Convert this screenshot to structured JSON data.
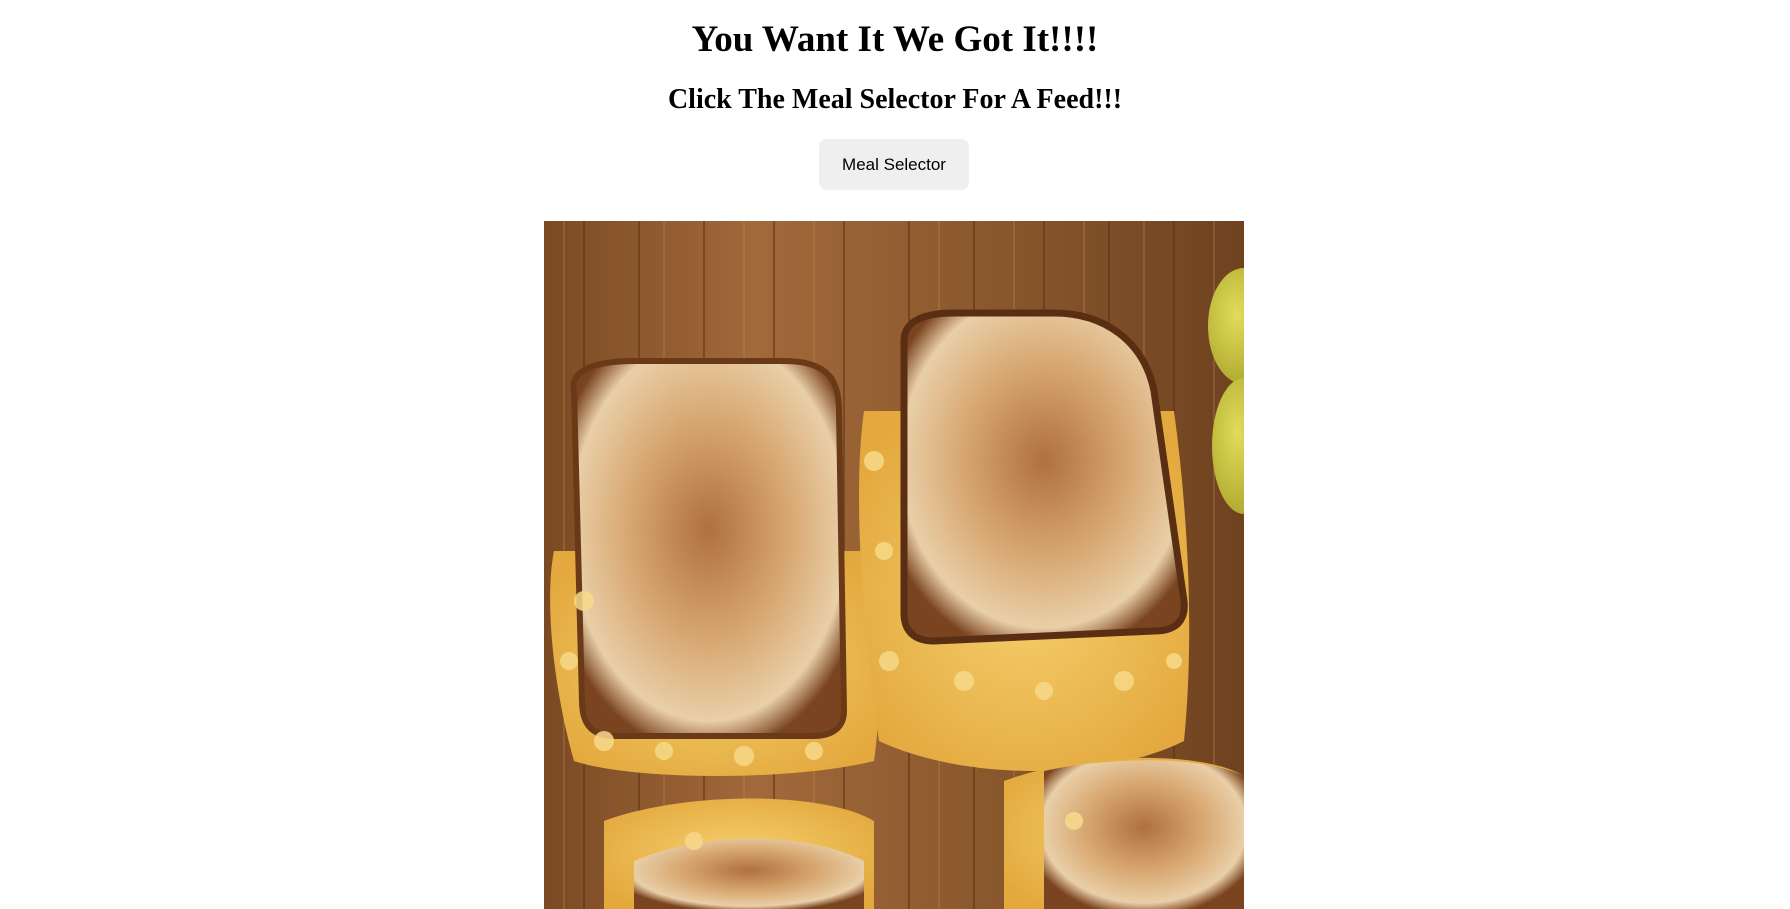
{
  "header": {
    "title": "You Want It We Got It!!!!",
    "subtitle": "Click The Meal Selector For A Feed!!!"
  },
  "controls": {
    "meal_selector_label": "Meal Selector"
  },
  "image": {
    "subject": "grilled-mac-and-cheese-sandwich",
    "colors": {
      "board": "#8a5a2e",
      "toast": "#c98a4a",
      "cheese": "#f0c25a",
      "pickle": "#c8c43a"
    }
  }
}
